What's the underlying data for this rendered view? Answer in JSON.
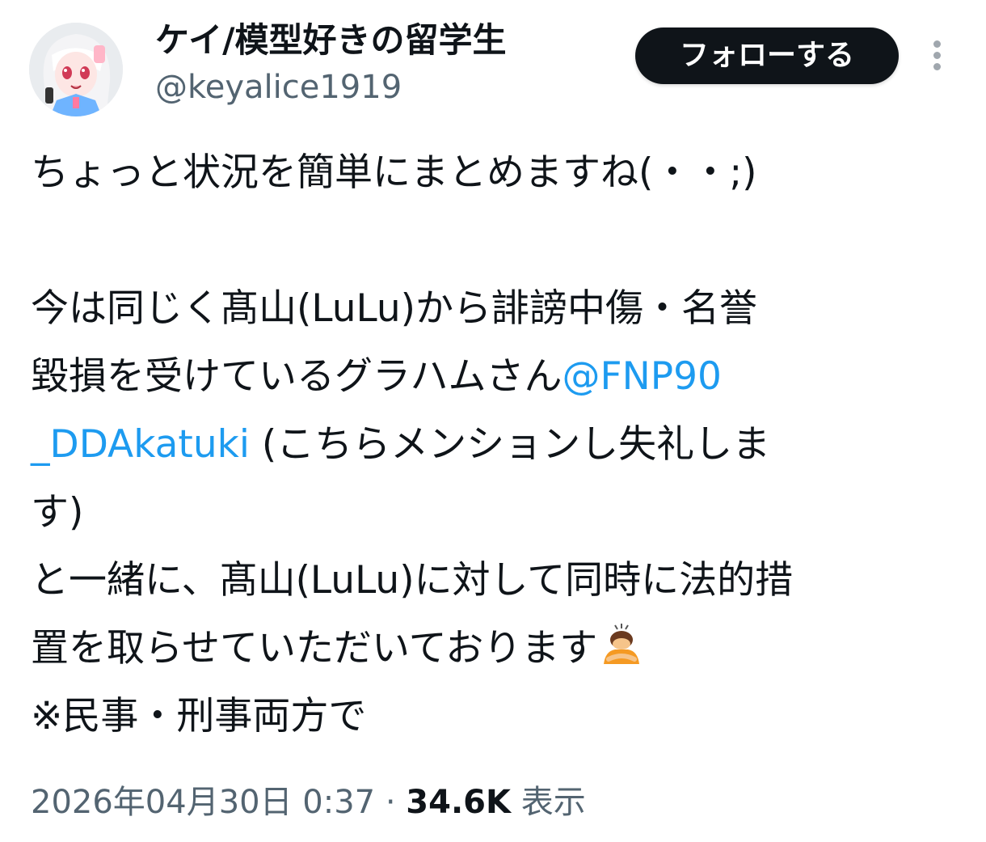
{
  "author": {
    "display_name": "ケイ/模型好きの留学生",
    "handle": "@keyalice1919",
    "avatar_icon": "anime-girl-avatar"
  },
  "actions": {
    "follow_label": "フォローする",
    "more_icon": "vertical-dots-icon"
  },
  "tweet": {
    "line1": "ちょっと状況を簡単にまとめますね(・・;)",
    "line2": "今は同じく髙山(LuLu)から誹謗中傷・名誉",
    "line3_text": "毀損を受けているグラハムさん",
    "mention_part1": "@FNP90",
    "mention_part2": "_DDAkatuki",
    "line4_text": " (こちらメンションし失礼しま",
    "line5": "す)",
    "line6": "と一緒に、髙山(LuLu)に対して同時に法的措",
    "line7_text": "置を取らせていただいております",
    "emoji_name": "person-bowing-emoji",
    "line8": "※民事・刑事両方で"
  },
  "meta": {
    "timestamp": "2026年04月30日 0:37",
    "separator": " · ",
    "views_count": "34.6K",
    "views_label": " 表示"
  },
  "colors": {
    "link": "#1d9bf0",
    "text": "#0f1419",
    "secondary": "#536471",
    "follow_bg": "#0f1419"
  }
}
